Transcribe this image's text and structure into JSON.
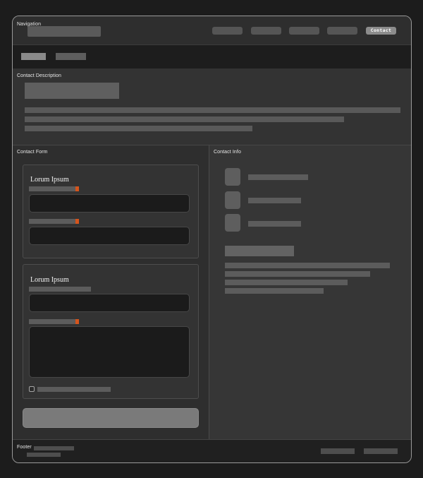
{
  "sections": {
    "navigation": "Navigation",
    "description": "Contact Description",
    "form": "Contact Form",
    "info": "Contact Info",
    "footer": "Footer"
  },
  "nav": {
    "active_link": "Contact"
  },
  "form": {
    "card1_title": "Lorum Ipsum",
    "card2_title": "Lorum Ipsum"
  }
}
